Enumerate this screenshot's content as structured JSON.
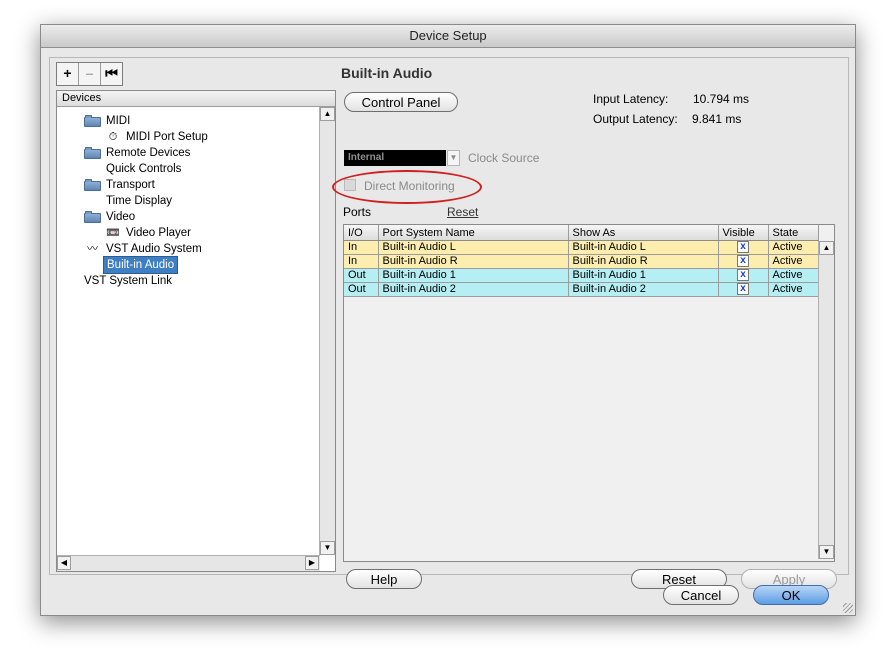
{
  "window": {
    "title": "Device Setup"
  },
  "toolbar": {
    "add": "+",
    "remove": "–",
    "reset_view": "⏮"
  },
  "devices": {
    "header": "Devices",
    "items": [
      {
        "label": "MIDI",
        "icon": "folder-icon",
        "level": 0
      },
      {
        "label": "MIDI Port Setup",
        "icon": "midi-port-icon",
        "level": 1
      },
      {
        "label": "Remote Devices",
        "icon": "folder-icon",
        "level": 0
      },
      {
        "label": "Quick Controls",
        "icon": "",
        "level": 1
      },
      {
        "label": "Transport",
        "icon": "folder-icon",
        "level": 0
      },
      {
        "label": "Time Display",
        "icon": "",
        "level": 1
      },
      {
        "label": "Video",
        "icon": "folder-icon",
        "level": 0
      },
      {
        "label": "Video Player",
        "icon": "video-icon",
        "level": 1
      },
      {
        "label": "VST Audio System",
        "icon": "audio-system-icon",
        "level": 0
      },
      {
        "label": "Built-in Audio",
        "icon": "",
        "level": 1,
        "selected": true
      },
      {
        "label": "VST System Link",
        "icon": "",
        "level": -1
      }
    ]
  },
  "panel": {
    "title": "Built-in Audio",
    "control_panel_label": "Control Panel",
    "input_latency_label": "Input Latency:",
    "input_latency_value": "10.794 ms",
    "output_latency_label": "Output Latency:",
    "output_latency_value": "9.841 ms",
    "clock_source_value": "Internal",
    "clock_source_label": "Clock Source",
    "direct_monitoring_label": "Direct Monitoring",
    "ports_label": "Ports",
    "reset_link": "Reset"
  },
  "ports_table": {
    "columns": [
      "I/O",
      "Port System Name",
      "Show As",
      "Visible",
      "State"
    ],
    "rows": [
      {
        "io": "In",
        "port": "Built-in Audio L",
        "show_as": "Built-in Audio L",
        "visible": "x",
        "state": "Active",
        "kind": "in"
      },
      {
        "io": "In",
        "port": "Built-in Audio R",
        "show_as": "Built-in Audio R",
        "visible": "x",
        "state": "Active",
        "kind": "in"
      },
      {
        "io": "Out",
        "port": "Built-in Audio 1",
        "show_as": "Built-in Audio 1",
        "visible": "x",
        "state": "Active",
        "kind": "out"
      },
      {
        "io": "Out",
        "port": "Built-in Audio 2",
        "show_as": "Built-in Audio 2",
        "visible": "x",
        "state": "Active",
        "kind": "out"
      }
    ]
  },
  "buttons": {
    "help": "Help",
    "reset": "Reset",
    "apply": "Apply",
    "cancel": "Cancel",
    "ok": "OK"
  },
  "colors": {
    "input_row": "#fdeeaf",
    "output_row": "#b5eef3",
    "selection": "#3e7fc4",
    "highlight_circle": "#d02020"
  }
}
